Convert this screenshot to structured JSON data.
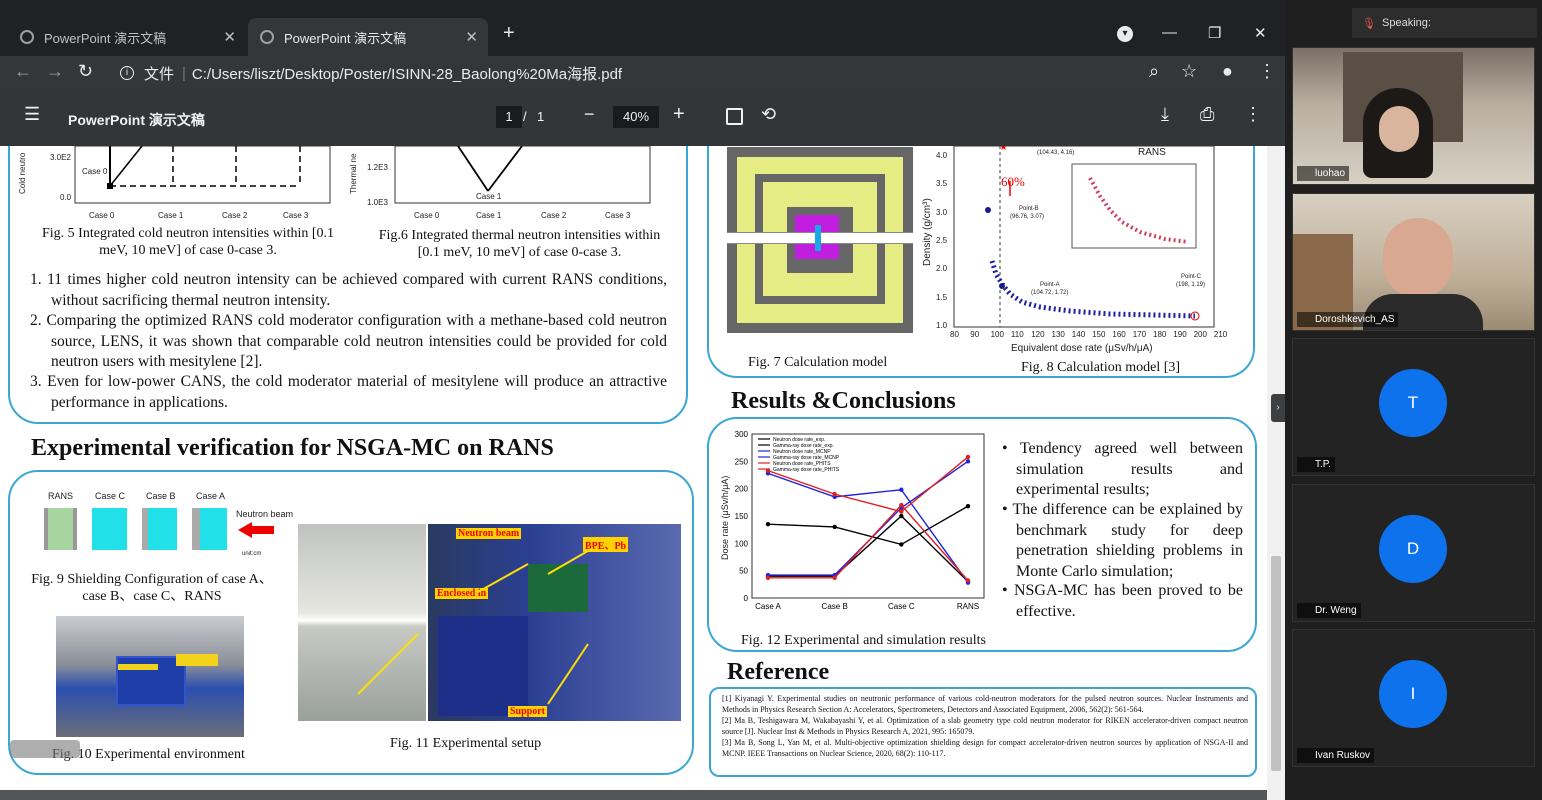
{
  "browser": {
    "tabs": [
      {
        "label": "PowerPoint 演示文稿"
      },
      {
        "label": "PowerPoint 演示文稿"
      }
    ],
    "new_tab": "+",
    "window_controls": {
      "minimize": "—",
      "restore": "❐",
      "close": "✕",
      "profile": "▾"
    },
    "address": {
      "scheme_label": "文件",
      "url": "C:/Users/liszt/Desktop/Poster/ISINN-28_Baolong%20Ma海报.pdf"
    }
  },
  "pdf_viewer": {
    "title": "PowerPoint 演示文稿",
    "page_current": "1",
    "page_sep": "/",
    "page_total": "1",
    "zoom": "40%",
    "minus": "−",
    "plus": "+"
  },
  "poster": {
    "fig5_caption": "Fig. 5 Integrated cold neutron intensities within [0.1 meV, 10 meV] of case 0-case 3.",
    "fig5_ylabel": "Cold neutro",
    "fig5_yticks": [
      "3.0E2",
      "0.0"
    ],
    "fig5_case_label": "Case 0",
    "fig5_xticks": [
      "Case 0",
      "Case 1",
      "Case 2",
      "Case 3"
    ],
    "fig6_caption": "Fig.6 Integrated thermal neutron intensities within [0.1 meV, 10 meV] of case 0-case 3.",
    "fig6_ylabel": "Thermal ne",
    "fig6_yticks": [
      "1.2E3",
      "1.0E3"
    ],
    "fig6_case_label": "Case 1",
    "fig6_xticks": [
      "Case 0",
      "Case 1",
      "Case 2",
      "Case 3"
    ],
    "bullets": [
      "1.  11 times higher cold neutron intensity can be achieved compared with current RANS conditions, without sacrificing thermal neutron intensity.",
      "2.  Comparing the optimized RANS cold moderator configuration with a methane-based cold neutron source, LENS, it was shown that comparable cold neutron intensities could be provided for cold neutron users with mesitylene [2].",
      "3.  Even for low-power CANS, the cold moderator material of mesitylene will produce an attractive performance in applications."
    ],
    "section_exp": "Experimental verification for NSGA-MC on RANS",
    "fig9_labels": [
      "RANS",
      "Case C",
      "Case B",
      "Case A"
    ],
    "fig9_neutron": "Neutron beam",
    "fig9_unit": "unit:cm",
    "fig9_caption": "Fig. 9 Shielding Configuration of case A、case B、case C、RANS",
    "fig10_caption": "Fig. 10 Experimental environment",
    "fig11_caption": "Fig. 11  Experimental setup",
    "fig11_tags": {
      "neutron": "Neutron beam",
      "bpe": "BPE、Pb",
      "enclosed": "Enclosed in",
      "support": "Support"
    },
    "fig7_caption": "Fig. 7 Calculation model",
    "fig8_caption": "Fig. 8 Calculation model [3]",
    "fig8_ylabel": "Density (g/cm³)",
    "fig8_xlabel": "Equivalent dose rate (μSv/h/μA)",
    "fig8_xticks": [
      "80",
      "90",
      "100",
      "110",
      "120",
      "130",
      "140",
      "150",
      "160",
      "170",
      "180",
      "190",
      "200",
      "210"
    ],
    "fig8_yticks": [
      "4.0",
      "3.5",
      "3.0",
      "2.5",
      "2.0",
      "1.5",
      "1.0"
    ],
    "fig8_rans": "RANS",
    "fig8_pct": "60%",
    "fig8_points": {
      "top": "(104.43, 4.16)",
      "b_name": "Point-B",
      "b": "(96.76, 3.07)",
      "a_name": "Point-A",
      "a": "(104.72, 1.72)",
      "c_name": "Point-C",
      "c": "(198, 1.19)"
    },
    "section_results": "Results &Conclusions",
    "fig12_caption": "Fig. 12  Experimental and simulation results",
    "fig12_ylabel": "Dose rate (μSv/h/μA)",
    "results_bullets": [
      "• Tendency agreed well between simulation results and experimental results;",
      "• The difference can be explained by benchmark study for deep penetration shielding problems in Monte Carlo simulation;",
      "• NSGA-MC has been proved to be effective."
    ],
    "section_ref": "Reference",
    "refs": [
      "[1] Kiyanagi Y. Experimental studies on neutronic performance of various cold-neutron moderators for the pulsed neutron sources. Nuclear Instruments and Methods in Physics Research Section A: Accelerators, Spectrometers, Detectors and Associated Equipment, 2006, 562(2): 561-564.",
      "[2] Ma B, Teshigawara M, Wakabayashi Y, et al. Optimization of a slab geometry type cold neutron moderator for RIKEN accelerator-driven compact neutron source [J]. Nuclear Inst & Methods in Physics Research A, 2021, 995: 165079.",
      "[3] Ma B, Song L, Yan M, et al. Multi-objective optimization shielding design for compact accelerator-driven neutron sources by application of NSGA-II and MCNP. IEEE Transactions on Nuclear Science, 2020, 68(2): 110-117."
    ]
  },
  "chart_data": {
    "type": "line",
    "categories": [
      "Case A",
      "Case B",
      "Case C",
      "RANS"
    ],
    "ylim": [
      0,
      300
    ],
    "yticks": [
      "300",
      "250",
      "200",
      "150",
      "100",
      "50",
      "0"
    ],
    "ylabel": "Dose rate (μSv/h/μA)",
    "series": [
      {
        "name": "Neutron dose rate_exp.",
        "color": "#000000",
        "values": [
          135,
          130,
          98,
          168
        ]
      },
      {
        "name": "Gamma-ray dose rate_exp.",
        "color": "#000000",
        "values": [
          40,
          40,
          150,
          30
        ]
      },
      {
        "name": "Neutron dose rate_MCNP",
        "color": "#2222dd",
        "values": [
          228,
          185,
          198,
          28
        ]
      },
      {
        "name": "Gamma-ray dose rate_MCNP",
        "color": "#2222dd",
        "values": [
          42,
          42,
          165,
          250
        ]
      },
      {
        "name": "Neutron dose rate_PHITS",
        "color": "#e02020",
        "values": [
          233,
          190,
          158,
          258
        ]
      },
      {
        "name": "Gamma-ray dose rate_PHITS",
        "color": "#e02020",
        "values": [
          37,
          37,
          170,
          32
        ]
      }
    ]
  },
  "meeting": {
    "speaking": "Speaking:",
    "participants": [
      {
        "name": "luohao",
        "video": true
      },
      {
        "name": "Doroshkevich_AS",
        "video": true
      },
      {
        "name": "T.P.",
        "initial": "T"
      },
      {
        "name": "Dr. Weng",
        "initial": "D"
      },
      {
        "name": "Ivan Ruskov",
        "initial": "I"
      }
    ]
  },
  "colors": {
    "accent": "#3aa7d6",
    "avatar": "#0e72ed"
  }
}
